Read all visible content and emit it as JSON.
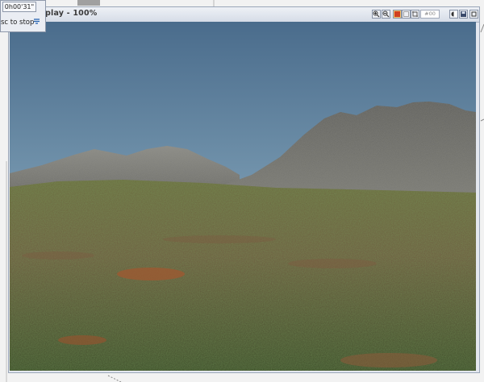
{
  "timer": {
    "time": "0h00'31\"",
    "hint": "sc to stop"
  },
  "window": {
    "title": "play - 100%"
  },
  "toolbar": {
    "zoom_in_icon": "zoom-in-icon",
    "zoom_out_icon": "zoom-out-icon",
    "field_value": "#00"
  }
}
